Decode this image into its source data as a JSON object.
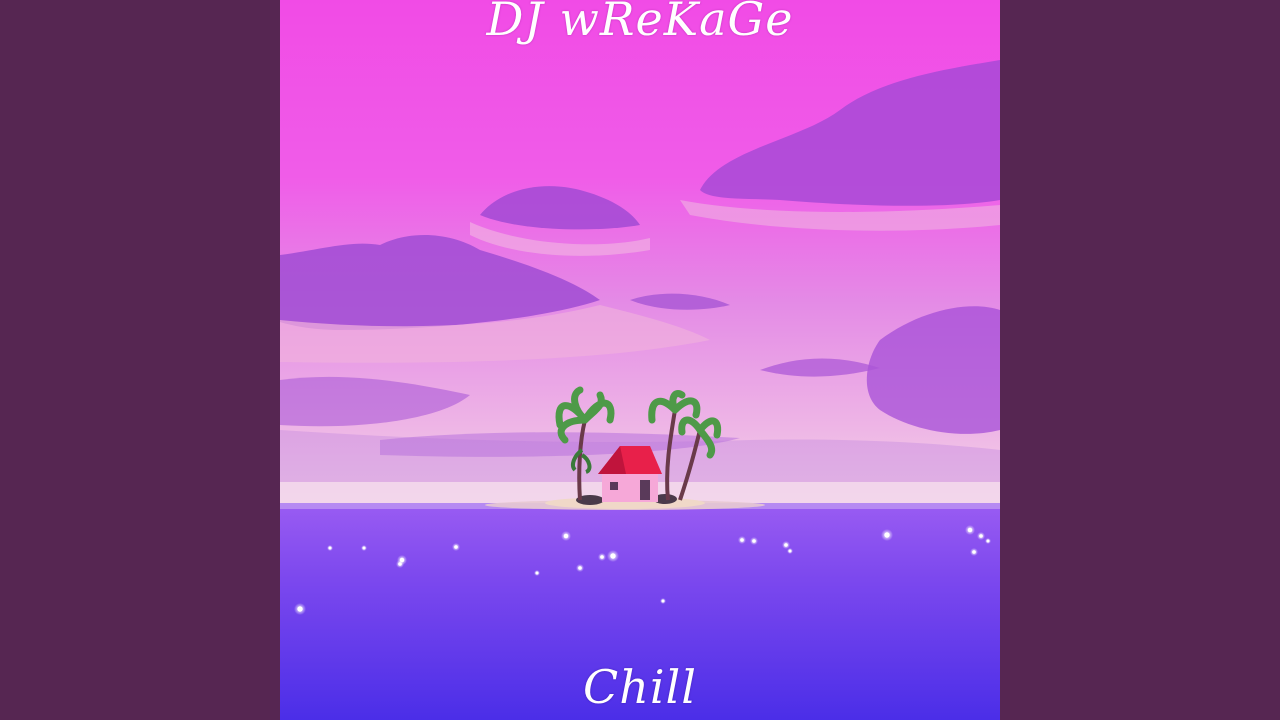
{
  "album": {
    "artist": "DJ wReKaGe",
    "title": "Chill"
  },
  "colors": {
    "letterbox": "#562652",
    "sky_top": "#f542e8",
    "sky_mid": "#e27ae8",
    "horizon_glow": "#f2c8e6",
    "sea_top": "#8a4ff0",
    "sea_bottom": "#4a2ee6",
    "cloud": "#a04cd8",
    "house_roof": "#e8204a",
    "house_wall": "#f6a6d8",
    "palm_leaf": "#4f9a4a",
    "text": "#ffffff"
  },
  "scene": {
    "description_icons": [
      "palm-tree-icon",
      "house-icon",
      "island-icon",
      "sparkle-icon"
    ]
  }
}
